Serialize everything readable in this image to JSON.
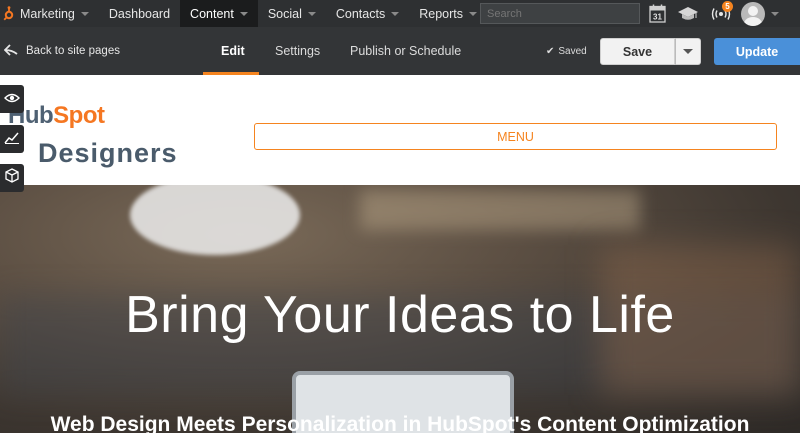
{
  "topnav": {
    "items": [
      {
        "label": "Marketing",
        "dropdown": true
      },
      {
        "label": "Dashboard",
        "dropdown": false
      },
      {
        "label": "Content",
        "dropdown": true,
        "active": true
      },
      {
        "label": "Social",
        "dropdown": true
      },
      {
        "label": "Contacts",
        "dropdown": true
      },
      {
        "label": "Reports",
        "dropdown": true
      }
    ],
    "search_placeholder": "Search",
    "calendar_day": "31",
    "notification_count": "5",
    "icons": [
      "sprocket-logo-icon",
      "calendar-icon",
      "academy-cap-icon",
      "notifications-icon",
      "avatar",
      "chevron-down-icon"
    ]
  },
  "editor": {
    "back_label": "Back to site pages",
    "tabs": [
      "Edit",
      "Settings",
      "Publish or Schedule"
    ],
    "active_tab": "Edit",
    "saved_label": "Saved",
    "save_label": "Save",
    "update_label": "Update"
  },
  "site": {
    "logo_text_1": "HubSpot",
    "logo_text_2": "Designers",
    "menu_label": "MENU"
  },
  "hero": {
    "title": "Bring Your Ideas to Life",
    "subtitle": "Web Design Meets Personalization in HubSpot's Content Optimization"
  },
  "colors": {
    "nav_bg": "#2e3032",
    "accent_orange": "#f5841f",
    "update_blue": "#4a90d9"
  }
}
